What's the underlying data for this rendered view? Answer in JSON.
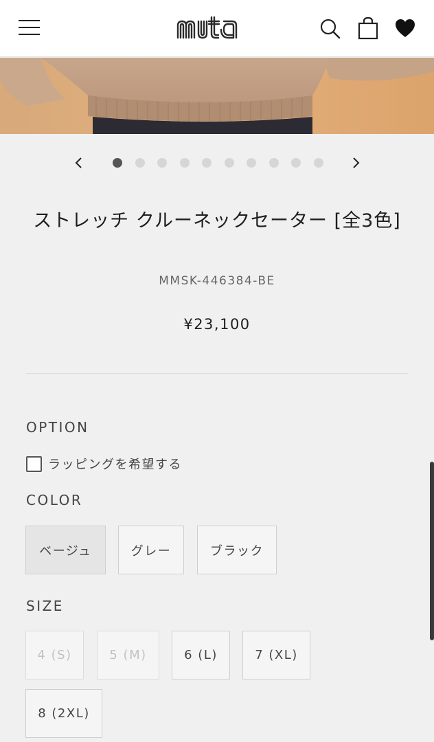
{
  "header": {
    "logo_text": "muta",
    "icons": [
      "hamburger-menu-icon",
      "search-icon",
      "shopping-bag-icon",
      "heart-icon"
    ]
  },
  "carousel": {
    "slide_count": 10,
    "active_index": 0
  },
  "product": {
    "title": "ストレッチ クルーネックセーター [全3色]",
    "sku": "MMSK-446384-BE",
    "price": "¥23,100"
  },
  "option": {
    "label": "OPTION",
    "wrapping_label": "ラッピングを希望する",
    "wrapping_checked": false
  },
  "color": {
    "label": "COLOR",
    "options": [
      "ベージュ",
      "グレー",
      "ブラック"
    ],
    "selected": "ベージュ"
  },
  "size": {
    "label": "SIZE",
    "options": [
      "4 (S)",
      "5 (M)",
      "6 (L)",
      "7 (XL)",
      "8 (2XL)"
    ],
    "unavailable": [
      "4 (S)",
      "5 (M)"
    ]
  }
}
